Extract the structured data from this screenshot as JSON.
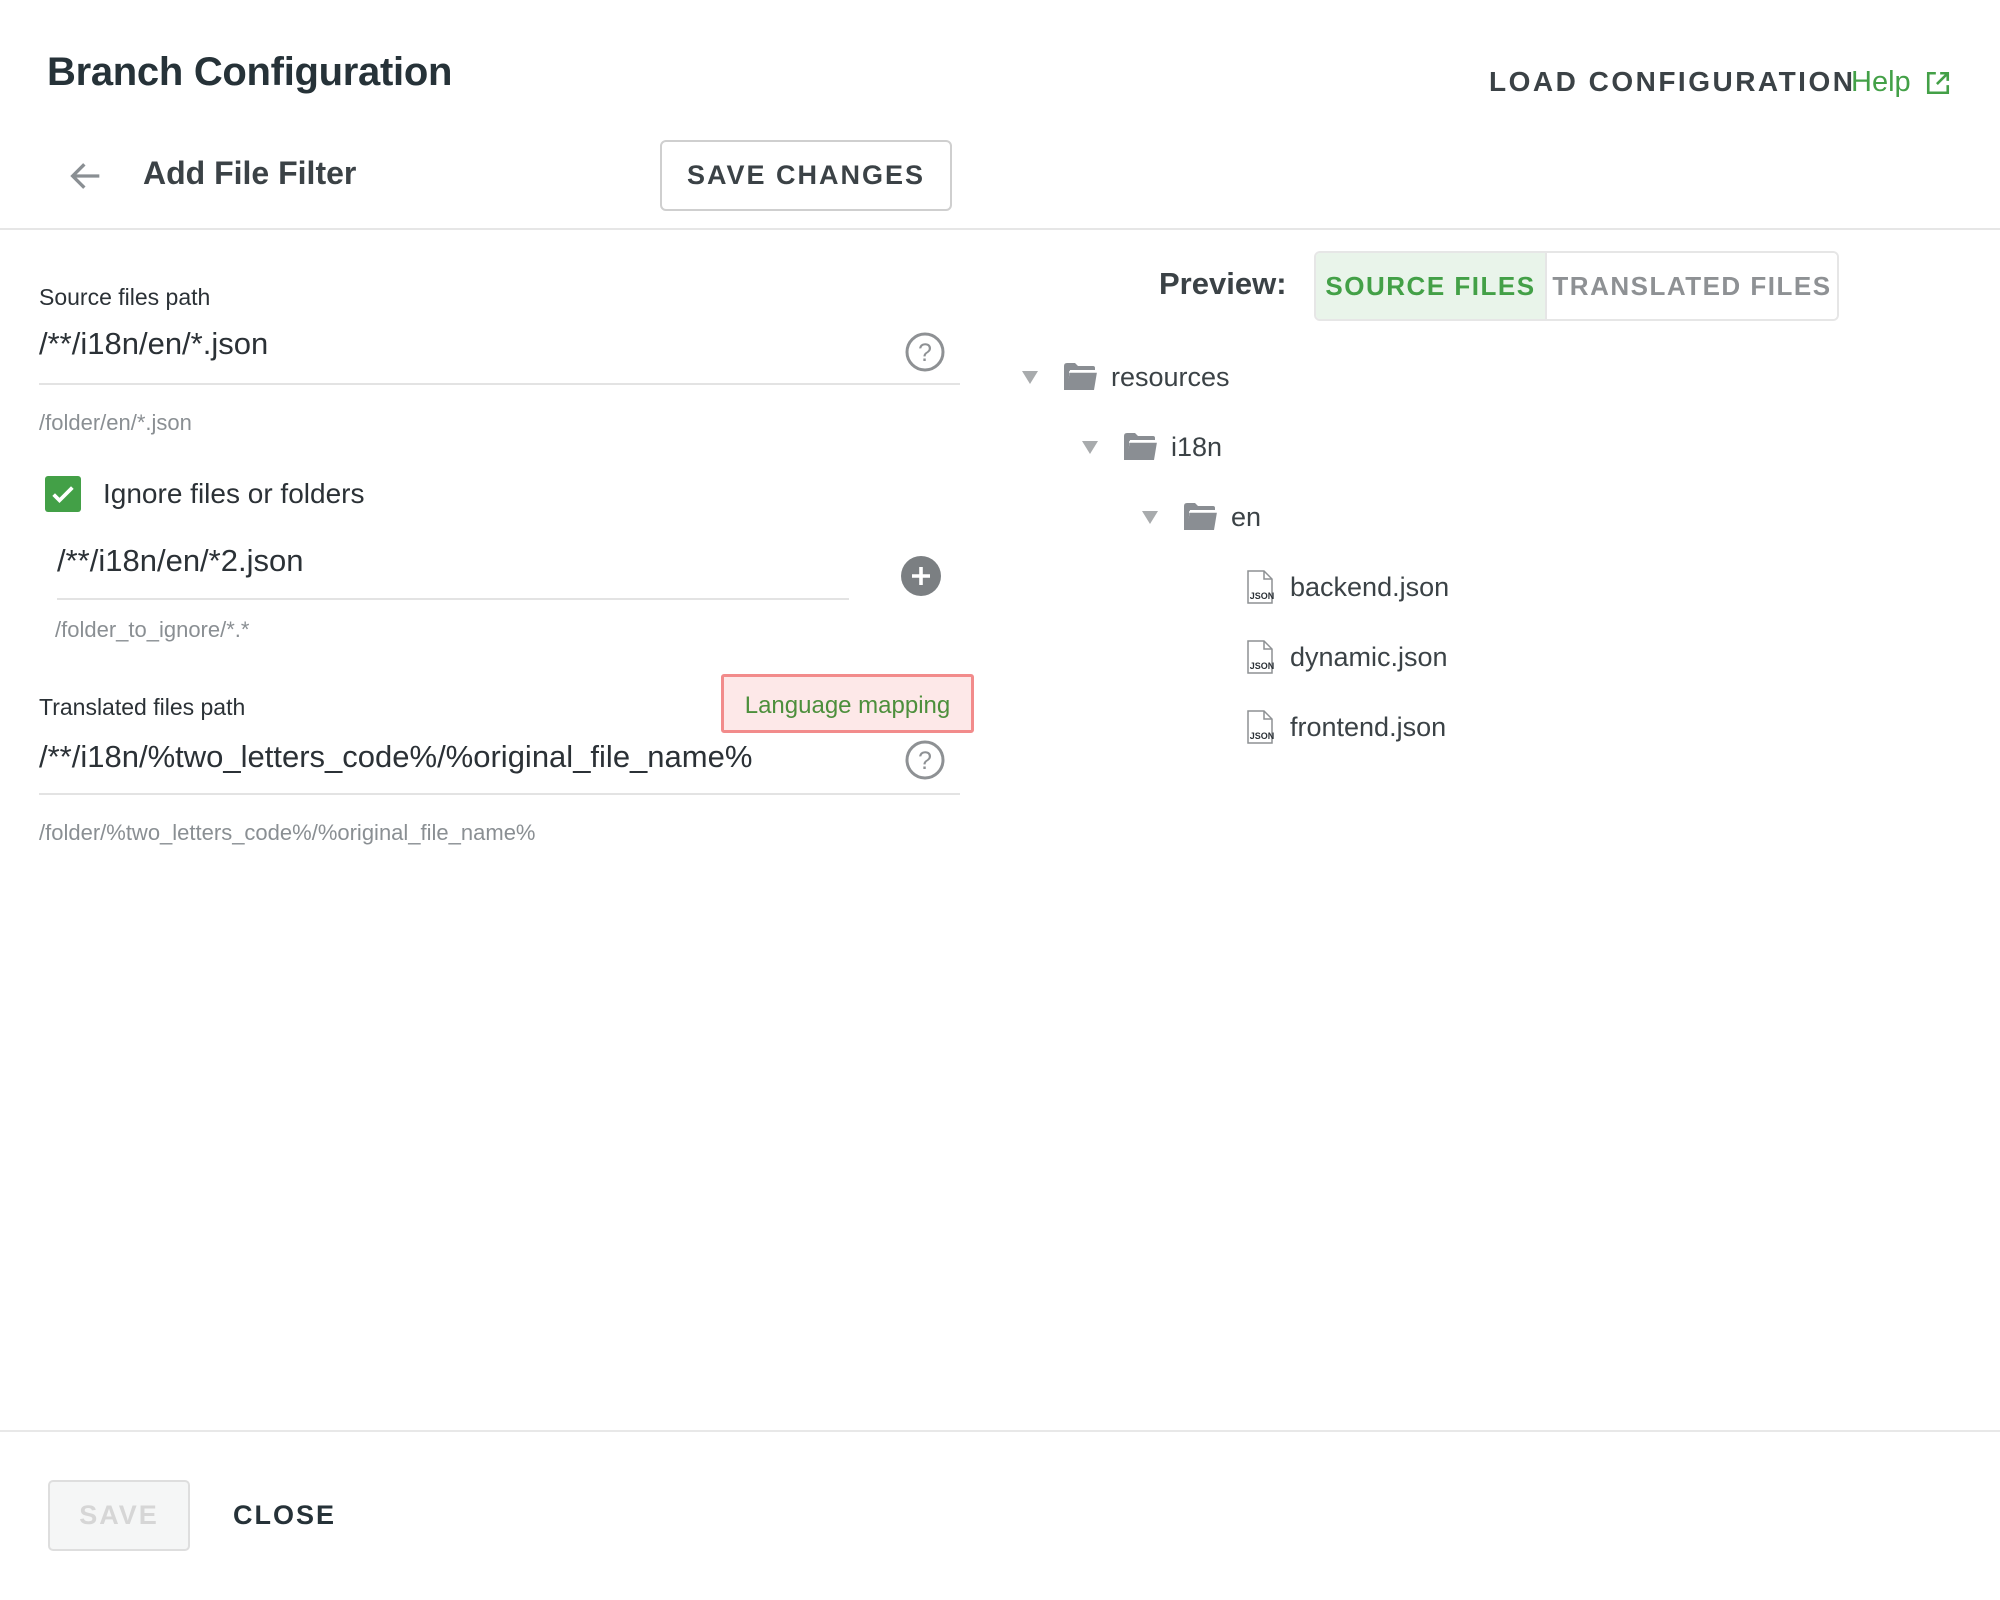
{
  "header": {
    "title": "Branch Configuration",
    "load_configuration": "LOAD CONFIGURATION",
    "help": "Help"
  },
  "subheader": {
    "title": "Add File Filter",
    "save_changes": "SAVE CHANGES"
  },
  "form": {
    "source": {
      "label": "Source files path",
      "value": "/**/i18n/en/*.json",
      "hint": "/folder/en/*.json"
    },
    "ignore": {
      "checkbox_label": "Ignore files or folders",
      "checked": true,
      "value": "/**/i18n/en/*2.json",
      "hint": "/folder_to_ignore/*.*"
    },
    "translated": {
      "label": "Translated files path",
      "language_mapping": "Language mapping",
      "value": "/**/i18n/%two_letters_code%/%original_file_name%",
      "hint": "/folder/%two_letters_code%/%original_file_name%"
    }
  },
  "preview": {
    "label": "Preview:",
    "tabs": [
      {
        "label": "SOURCE FILES",
        "active": true
      },
      {
        "label": "TRANSLATED FILES",
        "active": false
      }
    ],
    "tree": [
      {
        "name": "resources",
        "type": "folder",
        "depth": 0
      },
      {
        "name": "i18n",
        "type": "folder",
        "depth": 1
      },
      {
        "name": "en",
        "type": "folder",
        "depth": 2
      },
      {
        "name": "backend.json",
        "type": "json-file",
        "depth": 3
      },
      {
        "name": "dynamic.json",
        "type": "json-file",
        "depth": 3
      },
      {
        "name": "frontend.json",
        "type": "json-file",
        "depth": 3
      }
    ]
  },
  "footer": {
    "save": "SAVE",
    "close": "CLOSE"
  },
  "colors": {
    "accent": "#43a047",
    "highlight_border": "#f28b8b",
    "highlight_bg": "#fde8e8"
  }
}
